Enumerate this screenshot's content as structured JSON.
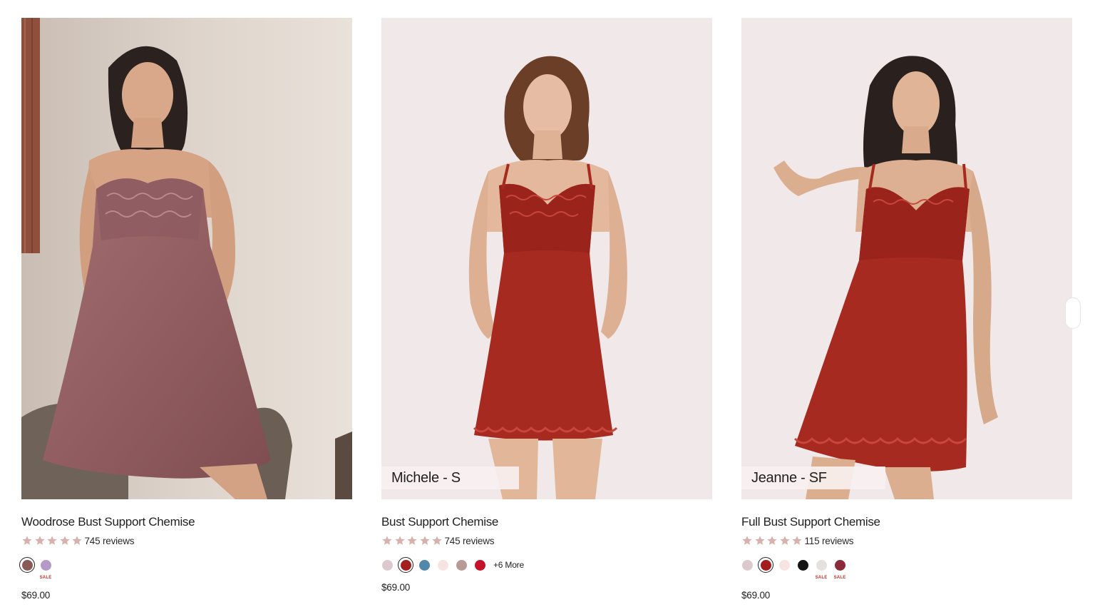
{
  "products": [
    {
      "title": "Woodrose Bust Support Chemise",
      "reviews": "745 reviews",
      "rating": 5,
      "price": "$69.00",
      "model_tag": "",
      "swatches": [
        {
          "color": "#8a5a57",
          "selected": true,
          "sale": ""
        },
        {
          "color": "#b49ac6",
          "selected": false,
          "sale": "SALE"
        }
      ],
      "more_label": ""
    },
    {
      "title": "Bust Support Chemise",
      "reviews": "745 reviews",
      "rating": 5,
      "price": "$69.00",
      "model_tag": "Michele - S",
      "swatches": [
        {
          "color": "#dcc9cd",
          "selected": false,
          "sale": ""
        },
        {
          "color": "#a31f1d",
          "selected": true,
          "sale": ""
        },
        {
          "color": "#4f88aa",
          "selected": false,
          "sale": ""
        },
        {
          "color": "#f7e4e2",
          "selected": false,
          "sale": ""
        },
        {
          "color": "#b89a94",
          "selected": false,
          "sale": ""
        },
        {
          "color": "#c4122b",
          "selected": false,
          "sale": ""
        }
      ],
      "more_label": "+6 More"
    },
    {
      "title": "Full Bust Support Chemise",
      "reviews": "115 reviews",
      "rating": 5,
      "price": "$69.00",
      "model_tag": "Jeanne - SF",
      "swatches": [
        {
          "color": "#dcc9cd",
          "selected": false,
          "sale": ""
        },
        {
          "color": "#a31f1d",
          "selected": true,
          "sale": ""
        },
        {
          "color": "#f7e4e2",
          "selected": false,
          "sale": ""
        },
        {
          "color": "#141414",
          "selected": false,
          "sale": ""
        },
        {
          "color": "#e6e0df",
          "selected": false,
          "sale": "SALE"
        },
        {
          "color": "#8c2a3c",
          "selected": false,
          "sale": "SALE"
        }
      ],
      "more_label": ""
    }
  ],
  "colors": {
    "star": "#d7b2ac",
    "sale_text": "#c0312b",
    "dress_woodrose": "#9a6466",
    "dress_red": "#a32a1f"
  }
}
